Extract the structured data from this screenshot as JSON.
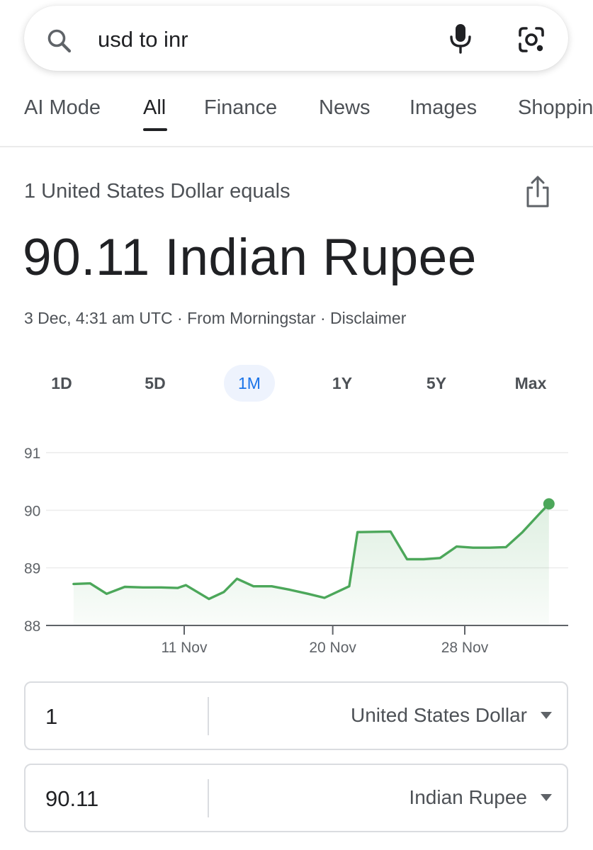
{
  "search": {
    "query": "usd to inr"
  },
  "tabs": [
    {
      "label": "AI Mode"
    },
    {
      "label": "All",
      "active": true
    },
    {
      "label": "Finance"
    },
    {
      "label": "News"
    },
    {
      "label": "Images"
    },
    {
      "label": "Shoppin"
    }
  ],
  "converter": {
    "equals_text": "1 United States Dollar equals",
    "result": "90.11 Indian Rupee",
    "timestamp": "3 Dec, 4:31 am UTC",
    "separator": "·",
    "source": "From Morningstar",
    "disclaimer": "Disclaimer",
    "from": {
      "amount": "1",
      "currency": "United States Dollar"
    },
    "to": {
      "amount": "90.11",
      "currency": "Indian Rupee"
    }
  },
  "ranges": [
    {
      "label": "1D"
    },
    {
      "label": "5D"
    },
    {
      "label": "1M",
      "active": true
    },
    {
      "label": "1Y"
    },
    {
      "label": "5Y"
    },
    {
      "label": "Max"
    }
  ],
  "colors": {
    "line": "#4ca75a",
    "accent": "#1a73e8"
  },
  "chart_data": {
    "type": "area",
    "ylim": [
      88,
      91
    ],
    "y_ticks": [
      "91",
      "90",
      "89",
      "88"
    ],
    "x_ticks": [
      {
        "label": "11 Nov",
        "day": 11
      },
      {
        "label": "20 Nov",
        "day": 20
      },
      {
        "label": "28 Nov",
        "day": 28
      }
    ],
    "series": [
      {
        "points": [
          [
            4.3,
            88.72
          ],
          [
            5.3,
            88.73
          ],
          [
            6.3,
            88.55
          ],
          [
            7.4,
            88.67
          ],
          [
            8.5,
            88.66
          ],
          [
            9.6,
            88.66
          ],
          [
            10.6,
            88.65
          ],
          [
            11.1,
            88.7
          ],
          [
            12.5,
            88.46
          ],
          [
            13.4,
            88.58
          ],
          [
            14.2,
            88.81
          ],
          [
            15.2,
            88.68
          ],
          [
            16.3,
            88.68
          ],
          [
            17.4,
            88.62
          ],
          [
            18.5,
            88.55
          ],
          [
            19.5,
            88.48
          ],
          [
            21.0,
            88.68
          ],
          [
            21.5,
            89.62
          ],
          [
            23.5,
            89.63
          ],
          [
            24.5,
            89.15
          ],
          [
            25.5,
            89.15
          ],
          [
            26.5,
            89.17
          ],
          [
            27.5,
            89.37
          ],
          [
            28.5,
            89.35
          ],
          [
            29.5,
            89.35
          ],
          [
            30.5,
            89.36
          ],
          [
            31.5,
            89.62
          ],
          [
            32.5,
            89.93
          ],
          [
            33.1,
            90.11
          ]
        ]
      }
    ]
  }
}
